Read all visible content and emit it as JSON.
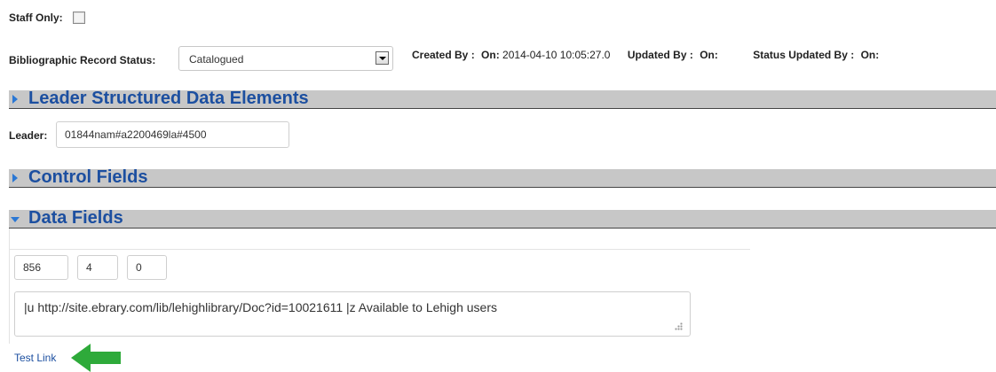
{
  "staff_only": {
    "label": "Staff Only:",
    "checked": false
  },
  "record_status": {
    "label": "Bibliographic Record Status:",
    "value": "Catalogued"
  },
  "audit": {
    "created_by_label": "Created By :",
    "created_on_label": "On:",
    "created_on_value": "2014-04-10 10:05:27.0",
    "updated_by_label": "Updated By :",
    "updated_on_label": "On:",
    "status_updated_by_label": "Status Updated By :",
    "status_updated_on_label": "On:"
  },
  "sections": {
    "leader": {
      "title": "Leader Structured Data Elements",
      "expanded": false
    },
    "control": {
      "title": "Control Fields",
      "expanded": false
    },
    "data": {
      "title": "Data Fields",
      "expanded": true
    }
  },
  "leader": {
    "label": "Leader:",
    "value": "01844nam#a2200469la#4500"
  },
  "data_field": {
    "tag": "856",
    "ind1": "4",
    "ind2": "0",
    "content": "|u http://site.ebrary.com/lib/lehighlibrary/Doc?id=10021611 |z Available to Lehigh users"
  },
  "test_link": {
    "label": "Test Link"
  },
  "annotation": {
    "arrow_color": "#2eaa3a",
    "direction": "left"
  }
}
